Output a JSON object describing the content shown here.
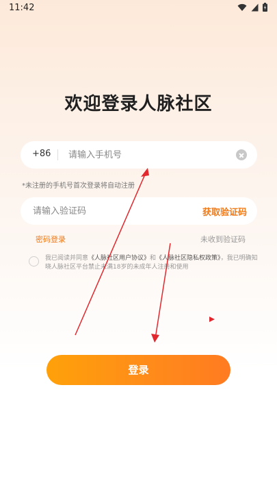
{
  "status_bar": {
    "time": "11:42"
  },
  "title": "欢迎登录人脉社区",
  "phone": {
    "country_code": "+86",
    "placeholder": "请输入手机号"
  },
  "phone_hint": "*未注册的手机号首次登录将自动注册",
  "verification": {
    "placeholder": "请输入验证码",
    "get_code_label": "获取验证码"
  },
  "links": {
    "password_login": "密码登录",
    "no_code": "未收到验证码"
  },
  "agreement": {
    "prefix": "我已阅读并同意",
    "user_agreement": "《人脉社区用户协议》",
    "and": "和",
    "privacy_policy": "《人脉社区隐私权政策》",
    "suffix": "，我已明确知晓人脉社区平台禁止未满18岁的未成年人注册和使用"
  },
  "login_button": "登录",
  "colors": {
    "accent": "#ef7a1a",
    "button_start": "#ffa10a",
    "button_end": "#ff7b20",
    "annotation": "#e0282e"
  }
}
